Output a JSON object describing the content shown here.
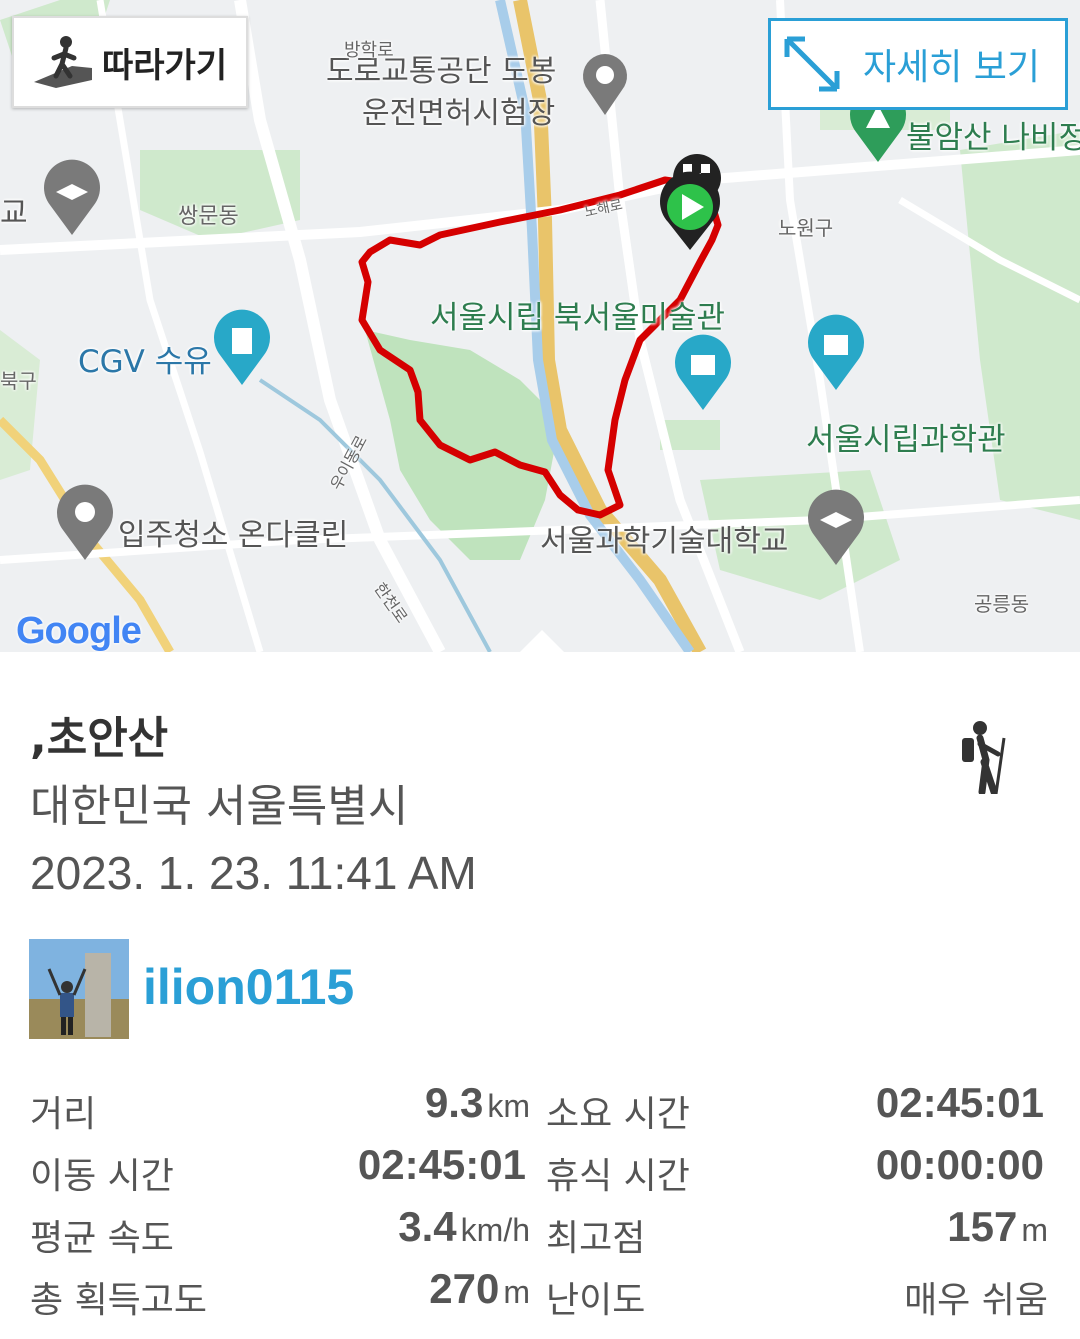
{
  "map": {
    "follow_button": "따라가기",
    "detail_button": "자세히 보기",
    "attribution": "Google",
    "labels": {
      "traffic_office": "도로교통공단 도봉",
      "license_center": "운전면허시험장",
      "bangak_road": "방학로",
      "bulamsan": "불암산 나비정",
      "ssangmun": "쌍문동",
      "cgv": "CGV 수유",
      "museum": "서울시립 북서울미술관",
      "science_museum": "서울시립과학관",
      "cleaning": "입주청소 온다클린",
      "university": "서울과학기술대학교",
      "nowon": "노원구",
      "gongneung": "공릉동",
      "nohae_road": "노해로",
      "bukgu": "북구",
      "uidong_road": "우이동로",
      "hancheon_road": "한천로",
      "school": "교"
    }
  },
  "route": {
    "name": ",초안산",
    "region": "대한민국 서울특별시",
    "datetime": "2023. 1. 23. 11:41 AM",
    "user": "ilion0115",
    "activity_icon": "hiking-icon"
  },
  "stats": [
    {
      "label": "거리",
      "value": "9.3",
      "unit": "km",
      "label2": "소요 시간",
      "value2": "02:45:01",
      "unit2": ""
    },
    {
      "label": "이동 시간",
      "value": "02:45:01",
      "unit": "",
      "label2": "휴식 시간",
      "value2": "00:00:00",
      "unit2": ""
    },
    {
      "label": "평균 속도",
      "value": "3.4",
      "unit": "km/h",
      "label2": "최고점",
      "value2": "157",
      "unit2": "m"
    },
    {
      "label": "총 획득고도",
      "value": "270",
      "unit": "m",
      "label2": "난이도",
      "value2": "매우 쉬움",
      "unit2": ""
    }
  ],
  "colors": {
    "accent": "#2a9fd6",
    "route": "#d50000",
    "park_green": "#b7dfb5",
    "river": "#a8cdea"
  }
}
